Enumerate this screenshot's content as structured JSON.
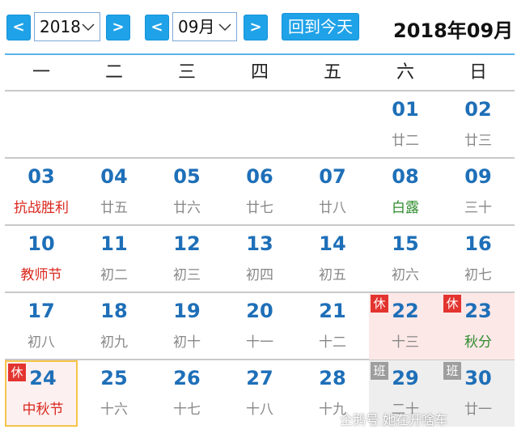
{
  "toolbar": {
    "prev_label": "<",
    "next_label": ">",
    "year_value": "2018",
    "month_value": "09月",
    "today_label": "回到今天",
    "title": "2018年09月"
  },
  "weekdays": [
    "一",
    "二",
    "三",
    "四",
    "五",
    "六",
    "日"
  ],
  "days": [
    {
      "num": "01",
      "sub": "廿二",
      "row": 0,
      "col": 5
    },
    {
      "num": "02",
      "sub": "廿三",
      "row": 0,
      "col": 6
    },
    {
      "num": "03",
      "sub": "抗战胜利",
      "row": 1,
      "col": 0,
      "color": "red"
    },
    {
      "num": "04",
      "sub": "廿五",
      "row": 1,
      "col": 1
    },
    {
      "num": "05",
      "sub": "廿六",
      "row": 1,
      "col": 2
    },
    {
      "num": "06",
      "sub": "廿七",
      "row": 1,
      "col": 3
    },
    {
      "num": "07",
      "sub": "廿八",
      "row": 1,
      "col": 4
    },
    {
      "num": "08",
      "sub": "白露",
      "row": 1,
      "col": 5,
      "color": "green"
    },
    {
      "num": "09",
      "sub": "三十",
      "row": 1,
      "col": 6
    },
    {
      "num": "10",
      "sub": "教师节",
      "row": 2,
      "col": 0,
      "color": "red"
    },
    {
      "num": "11",
      "sub": "初二",
      "row": 2,
      "col": 1
    },
    {
      "num": "12",
      "sub": "初三",
      "row": 2,
      "col": 2
    },
    {
      "num": "13",
      "sub": "初四",
      "row": 2,
      "col": 3
    },
    {
      "num": "14",
      "sub": "初五",
      "row": 2,
      "col": 4
    },
    {
      "num": "15",
      "sub": "初六",
      "row": 2,
      "col": 5
    },
    {
      "num": "16",
      "sub": "初七",
      "row": 2,
      "col": 6
    },
    {
      "num": "17",
      "sub": "初八",
      "row": 3,
      "col": 0
    },
    {
      "num": "18",
      "sub": "初九",
      "row": 3,
      "col": 1
    },
    {
      "num": "19",
      "sub": "初十",
      "row": 3,
      "col": 2
    },
    {
      "num": "20",
      "sub": "十一",
      "row": 3,
      "col": 3
    },
    {
      "num": "21",
      "sub": "十二",
      "row": 3,
      "col": 4
    },
    {
      "num": "22",
      "sub": "十三",
      "row": 3,
      "col": 5,
      "tag": "休"
    },
    {
      "num": "23",
      "sub": "秋分",
      "row": 3,
      "col": 6,
      "color": "green",
      "tag": "休"
    },
    {
      "num": "24",
      "sub": "中秋节",
      "row": 4,
      "col": 0,
      "color": "red",
      "tag": "休",
      "today": true
    },
    {
      "num": "25",
      "sub": "十六",
      "row": 4,
      "col": 1
    },
    {
      "num": "26",
      "sub": "十七",
      "row": 4,
      "col": 2
    },
    {
      "num": "27",
      "sub": "十八",
      "row": 4,
      "col": 3
    },
    {
      "num": "28",
      "sub": "十九",
      "row": 4,
      "col": 4
    },
    {
      "num": "29",
      "sub": "二十",
      "row": 4,
      "col": 5,
      "tag": "班"
    },
    {
      "num": "30",
      "sub": "廿一",
      "row": 4,
      "col": 6,
      "tag": "班"
    }
  ],
  "watermark": "企鹅号 她在开啥车",
  "colors": {
    "accent": "#1fa2e8",
    "date": "#1e6fb8",
    "festival": "#d9261c",
    "solar_term": "#2e8b2e",
    "holiday_bg": "#fde8e8",
    "workday_bg": "#eeeeee",
    "today_border": "#f6c44a"
  }
}
